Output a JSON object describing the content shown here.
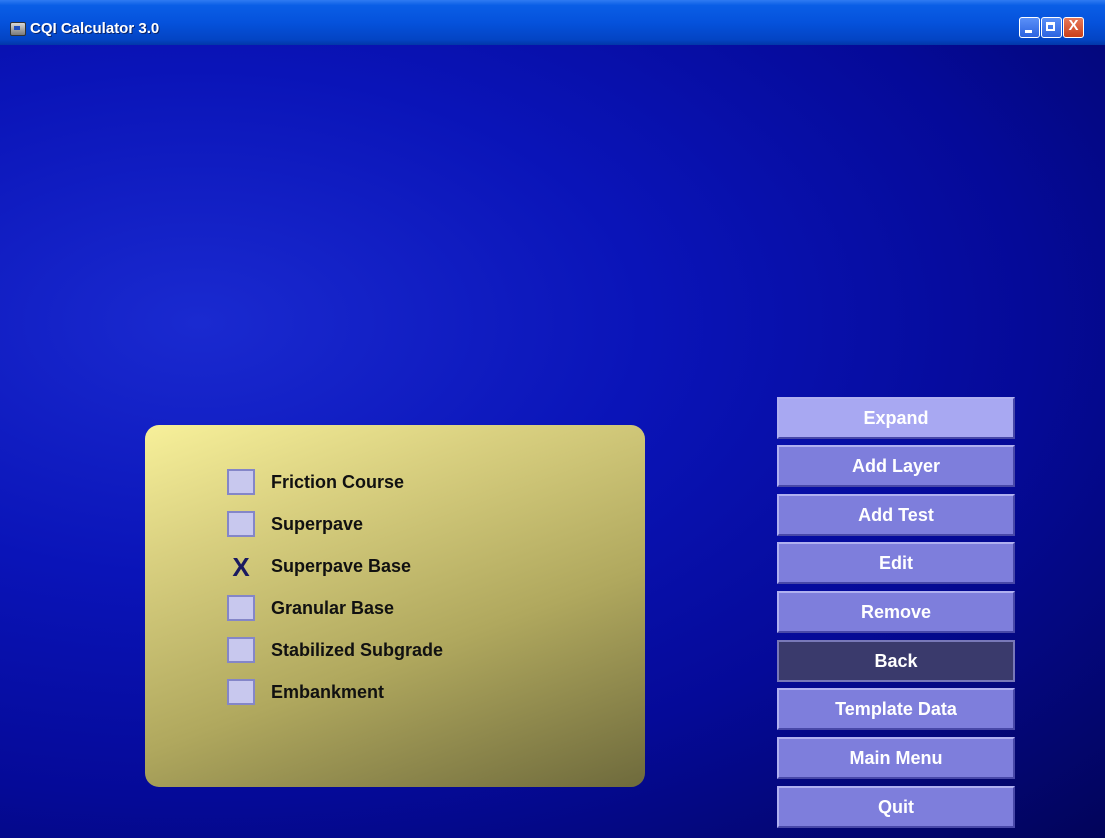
{
  "window": {
    "title": "CQI Calculator 3.0",
    "close_glyph": "X"
  },
  "layers": [
    {
      "label": "Friction Course",
      "checked": false
    },
    {
      "label": "Superpave",
      "checked": false
    },
    {
      "label": "Superpave Base",
      "checked": true,
      "mark": "X"
    },
    {
      "label": "Granular Base",
      "checked": false
    },
    {
      "label": "Stabilized Subgrade",
      "checked": false
    },
    {
      "label": "Embankment",
      "checked": false
    }
  ],
  "buttons": {
    "expand": "Expand",
    "add_layer": "Add Layer",
    "add_test": "Add Test",
    "edit": "Edit",
    "remove": "Remove",
    "back": "Back",
    "template_data": "Template Data",
    "main_menu": "Main Menu",
    "quit": "Quit"
  },
  "colors": {
    "background": "#0a14b8",
    "panel": "#d9d080",
    "button": "#7e7edc",
    "button_highlight": "#a8a8f2",
    "button_selected": "#3a3a6c"
  }
}
